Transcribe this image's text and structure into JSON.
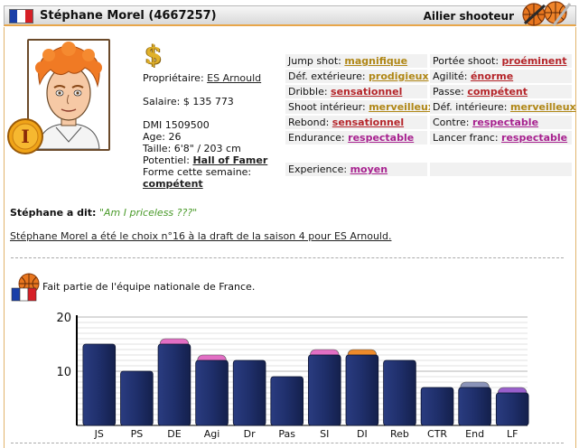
{
  "header": {
    "name": "Stéphane Morel (4667257)",
    "position": "Ailier shooteur"
  },
  "player": {
    "owner_label": "Propriétaire:",
    "owner": "ES Arnould",
    "salary": "Salaire: $ 135 773",
    "dmi": "DMI 1509500",
    "age": "Age: 26",
    "height": "Taille: 6'8\" / 203 cm",
    "potential_label": "Potentiel:",
    "potential": "Hall of Famer",
    "form_label": "Forme cette semaine:",
    "form": "compétent",
    "badge_number": "I"
  },
  "skills": [
    {
      "label": "Jump shot:",
      "value": "magnifique",
      "color": "gold"
    },
    {
      "label": "Portée shoot:",
      "value": "proéminent",
      "color": "red"
    },
    {
      "label": "Déf. extérieure:",
      "value": "prodigieux",
      "color": "gold"
    },
    {
      "label": "Agilité:",
      "value": "énorme",
      "color": "red"
    },
    {
      "label": "Dribble:",
      "value": "sensationnel",
      "color": "red"
    },
    {
      "label": "Passe:",
      "value": "compétent",
      "color": "red"
    },
    {
      "label": "Shoot intérieur:",
      "value": "merveilleux",
      "color": "gold"
    },
    {
      "label": "Déf. intérieure:",
      "value": "merveilleux",
      "color": "gold",
      "arrow": "↑"
    },
    {
      "label": "Rebond:",
      "value": "sensationnel",
      "color": "red"
    },
    {
      "label": "Contre:",
      "value": "respectable",
      "color": "purple"
    },
    {
      "label": "Endurance:",
      "value": "respectable",
      "color": "purple"
    },
    {
      "label": "Lancer franc:",
      "value": "respectable",
      "color": "purple"
    }
  ],
  "experience": {
    "label": "Experience:",
    "value": "moyen"
  },
  "quote": {
    "speaker": "Stéphane a dit:",
    "text": "\"Am I priceless ???\""
  },
  "draft_text": "Stéphane Morel a été le choix n°16 à la draft de la saison 4 pour ES Arnould.",
  "national_text": "Fait partie de l'équipe nationale de France.",
  "colors": {
    "bar_fill": "#1f2f6b",
    "bar_pink": "#e26fc4",
    "bar_orange": "#ee8a2a",
    "bar_grey": "#8a93b8",
    "bar_violet": "#9a60cc",
    "header_accent": "#e8a64a"
  },
  "chart_data": {
    "type": "bar",
    "categories": [
      "JS",
      "PS",
      "DE",
      "Agi",
      "Dr",
      "Pas",
      "SI",
      "DI",
      "Reb",
      "CTR",
      "End",
      "LF"
    ],
    "values": [
      15,
      10,
      15,
      12,
      12,
      9,
      13,
      13,
      12,
      7,
      7,
      6
    ],
    "caps": [
      null,
      null,
      "pink",
      "pink",
      null,
      null,
      "pink",
      "orange",
      null,
      null,
      "grey",
      "violet"
    ],
    "cap_values": [
      0,
      0,
      1,
      1,
      0,
      0,
      1,
      1,
      0,
      0,
      1,
      1
    ],
    "yticks": [
      10,
      20
    ],
    "ylim": [
      0,
      20
    ]
  }
}
